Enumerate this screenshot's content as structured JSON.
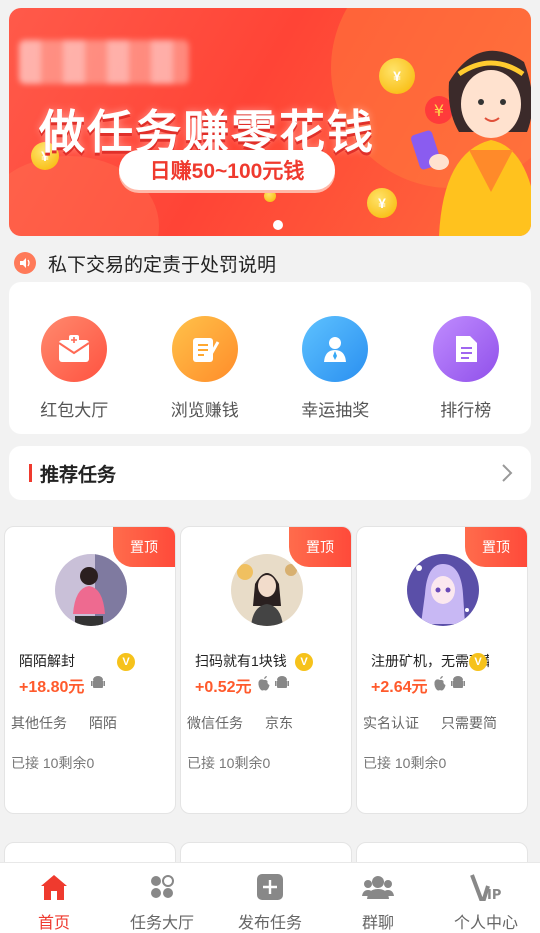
{
  "banner": {
    "headline": "做任务赚零花钱",
    "subline": "日赚50~100元钱",
    "coin_glyph": "¥"
  },
  "notice": {
    "text": "私下交易的定责于处罚说明"
  },
  "quick_menu": [
    {
      "label": "红包大厅",
      "icon": "red-envelope-icon",
      "color": "#ff6a55"
    },
    {
      "label": "浏览赚钱",
      "icon": "browse-note-icon",
      "color": "#ffa830"
    },
    {
      "label": "幸运抽奖",
      "icon": "lucky-draw-icon",
      "color": "#36a8f5"
    },
    {
      "label": "排行榜",
      "icon": "ranking-list-icon",
      "color": "#a066f0"
    }
  ],
  "recommended": {
    "title": "推荐任务"
  },
  "tasks": [
    {
      "badge": "置顶",
      "title": "陌陌解封",
      "price": "+18.80元",
      "platforms": [
        "android"
      ],
      "tags": [
        "其他任务",
        "陌陌"
      ],
      "stat": "已接 10剩余0"
    },
    {
      "badge": "置顶",
      "title": "扫码就有1块钱",
      "price": "+0.52元",
      "platforms": [
        "apple",
        "android"
      ],
      "tags": [
        "微信任务",
        "京东"
      ],
      "stat": "已接 10剩余0"
    },
    {
      "badge": "置顶",
      "title": "注册矿机，无需下载",
      "price": "+2.64元",
      "platforms": [
        "apple",
        "android"
      ],
      "tags": [
        "实名认证",
        "只需要简"
      ],
      "stat": "已接 10剩余0"
    }
  ],
  "tabbar": [
    {
      "label": "首页",
      "icon": "home-icon",
      "active": true
    },
    {
      "label": "任务大厅",
      "icon": "task-hall-icon",
      "active": false
    },
    {
      "label": "发布任务",
      "icon": "publish-plus-icon",
      "active": false
    },
    {
      "label": "群聊",
      "icon": "group-chat-icon",
      "active": false
    },
    {
      "label": "个人中心",
      "icon": "vip-profile-icon",
      "active": false
    }
  ],
  "colors": {
    "accent": "#ef3a2e",
    "price": "#ff5a2c"
  }
}
